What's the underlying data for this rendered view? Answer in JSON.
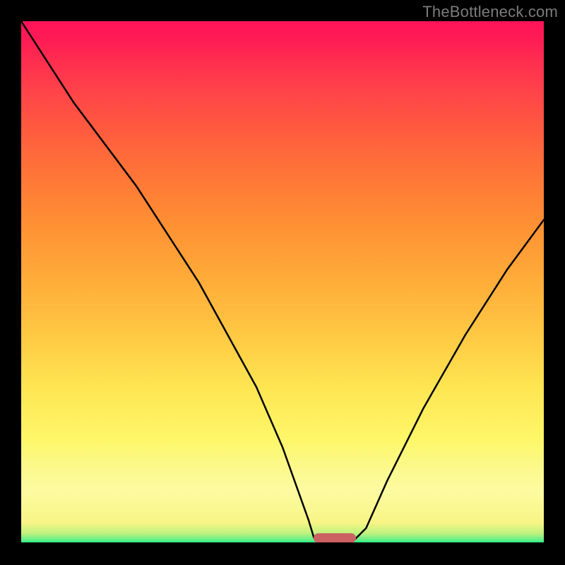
{
  "watermark": "TheBottleneck.com",
  "chart_data": {
    "type": "line",
    "title": "",
    "xlabel": "",
    "ylabel": "",
    "xlim": [
      0,
      100
    ],
    "ylim": [
      0,
      100
    ],
    "series": [
      {
        "name": "curve",
        "x": [
          0,
          10,
          22,
          34,
          45,
          50,
          55,
          56,
          60,
          63,
          66,
          70,
          77,
          85,
          93,
          100
        ],
        "values": [
          100,
          84.5,
          68.5,
          50,
          30,
          18.5,
          4.5,
          1.2,
          0,
          0,
          3,
          12,
          26,
          40,
          52.5,
          62
        ]
      }
    ],
    "marker": {
      "name": "pink-bar",
      "x_start": 56,
      "x_end": 64,
      "y": 0,
      "color": "#cc6164"
    },
    "background_gradient": {
      "bottom": "#00ef7f",
      "mid": "#fef768",
      "top": "#ff1458"
    }
  }
}
